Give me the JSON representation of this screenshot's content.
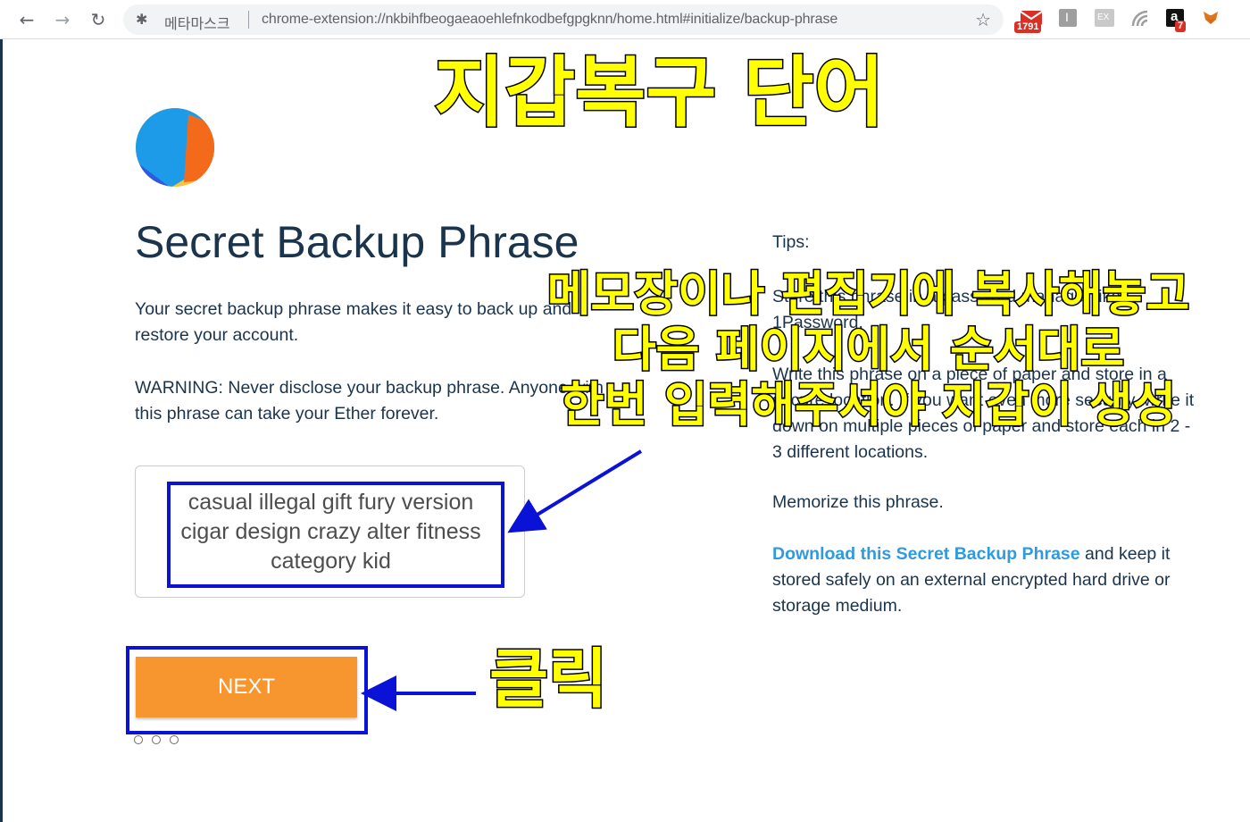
{
  "browser": {
    "site_name": "메타마스크",
    "url": "chrome-extension://nkbihfbeogaeaoehlefnkodbefgpgknn/home.html#initialize/backup-phrase",
    "extensions": [
      {
        "name": "gmail",
        "badge": "1791"
      },
      {
        "name": "ext-1",
        "letter": "I"
      },
      {
        "name": "ext-2",
        "letter": "EX"
      },
      {
        "name": "ext-3"
      },
      {
        "name": "ext-4",
        "letter": "a",
        "badge": "7"
      },
      {
        "name": "metamask"
      }
    ],
    "colors": {
      "accent": "#f7952f",
      "link": "#2f9ae0",
      "annotation_blue": "#0b12d8",
      "caption_yellow": "#ffff00"
    }
  },
  "page": {
    "title": "Secret Backup Phrase",
    "intro": "Your secret backup phrase makes it easy to back up and restore your account.",
    "warning": "WARNING: Never disclose your backup phrase. Anyone with this phrase can take your Ether forever.",
    "phrase": "casual illegal gift fury version cigar design crazy alter fitness category kid",
    "next_label": "NEXT",
    "tips_title": "Tips:",
    "tip_1": "Store this phrase in a password manager like 1Password.",
    "tip_2": "Write this phrase on a piece of paper and store in a secure location. If you want even more security, write it down on multiple pieces of paper and store each in 2 - 3 different locations.",
    "tip_3": "Memorize this phrase.",
    "tip_4_link": "Download this Secret Backup Phrase",
    "tip_4_rest": " and keep it stored safely on an external encrypted hard drive or storage medium.",
    "progress": {
      "current_step": 2,
      "total_steps": 3
    }
  },
  "annotations": {
    "caption_top": "지갑복구 단어",
    "caption_mid_1": "메모장이나 편집기에 복사해놓고",
    "caption_mid_2": "다음 페이지에서 순서대로",
    "caption_mid_3": "한번 입력해주셔야 지갑이 생성",
    "caption_click": "클릭"
  }
}
